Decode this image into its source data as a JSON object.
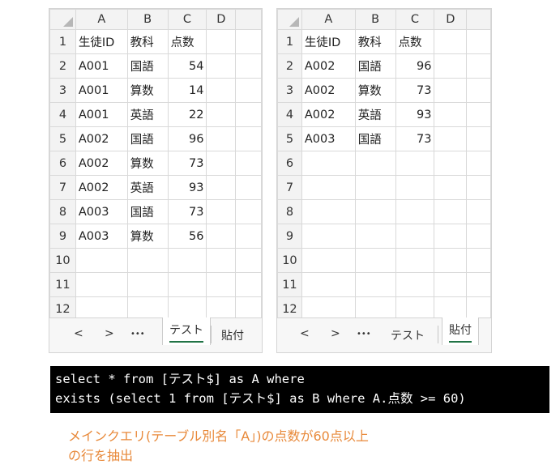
{
  "columns": [
    "A",
    "B",
    "C",
    "D"
  ],
  "row_numbers": [
    "1",
    "2",
    "3",
    "4",
    "5",
    "6",
    "7",
    "8",
    "9",
    "10",
    "11",
    "12"
  ],
  "left_sheet": {
    "rows": [
      [
        "生徒ID",
        "教科",
        "点数"
      ],
      [
        "A001",
        "国語",
        "54"
      ],
      [
        "A001",
        "算数",
        "14"
      ],
      [
        "A001",
        "英語",
        "22"
      ],
      [
        "A002",
        "国語",
        "96"
      ],
      [
        "A002",
        "算数",
        "73"
      ],
      [
        "A002",
        "英語",
        "93"
      ],
      [
        "A003",
        "国語",
        "73"
      ],
      [
        "A003",
        "算数",
        "56"
      ]
    ],
    "tabs": {
      "prev": "<",
      "next": ">",
      "more": "•••",
      "tab1": "テスト",
      "tab2": "貼付",
      "active": "tab1"
    }
  },
  "right_sheet": {
    "rows": [
      [
        "生徒ID",
        "教科",
        "点数"
      ],
      [
        "A002",
        "国語",
        "96"
      ],
      [
        "A002",
        "算数",
        "73"
      ],
      [
        "A002",
        "英語",
        "93"
      ],
      [
        "A003",
        "国語",
        "73"
      ]
    ],
    "tabs": {
      "prev": "<",
      "next": ">",
      "more": "•••",
      "tab1": "テスト",
      "tab2": "貼付",
      "active": "tab2"
    }
  },
  "code": {
    "line1": "select * from [テスト$] as A where",
    "line2": "exists (select 1 from [テスト$] as B where A.点数 >= 60)"
  },
  "caption": {
    "line1": "メインクエリ(テーブル別名「A」)の点数が60点以上",
    "line2": "の行を抽出"
  },
  "colors": {
    "accent_green": "#217346",
    "caption": "#e8893a"
  }
}
